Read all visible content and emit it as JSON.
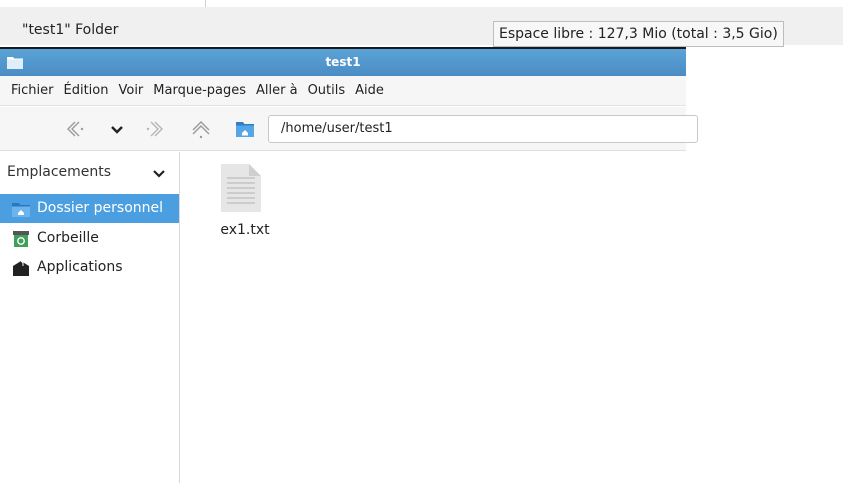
{
  "background_window": {
    "status_left": "\"test1\" Folder",
    "status_right": "Espace libre : 127,3 Mio (total : 3,5 Gio)"
  },
  "window": {
    "title": "test1",
    "titlebar_color": "#4b8cc4",
    "menu": [
      "Fichier",
      "Édition",
      "Voir",
      "Marque-pages",
      "Aller à",
      "Outils",
      "Aide"
    ],
    "toolbar": {
      "icons": [
        "back-icon",
        "history-dropdown-icon",
        "forward-icon",
        "up-icon",
        "home-folder-icon"
      ],
      "path": "/home/user/test1"
    },
    "sidebar": {
      "header": "Emplacements",
      "items": [
        {
          "label": "Dossier personnel",
          "icon": "home-folder-icon",
          "selected": true
        },
        {
          "label": "Corbeille",
          "icon": "trash-icon",
          "selected": false
        },
        {
          "label": "Applications",
          "icon": "applications-icon",
          "selected": false
        }
      ],
      "selection_color": "#4b9fe0"
    },
    "files": [
      {
        "name": "ex1.txt",
        "icon": "text-file-icon"
      }
    ]
  }
}
